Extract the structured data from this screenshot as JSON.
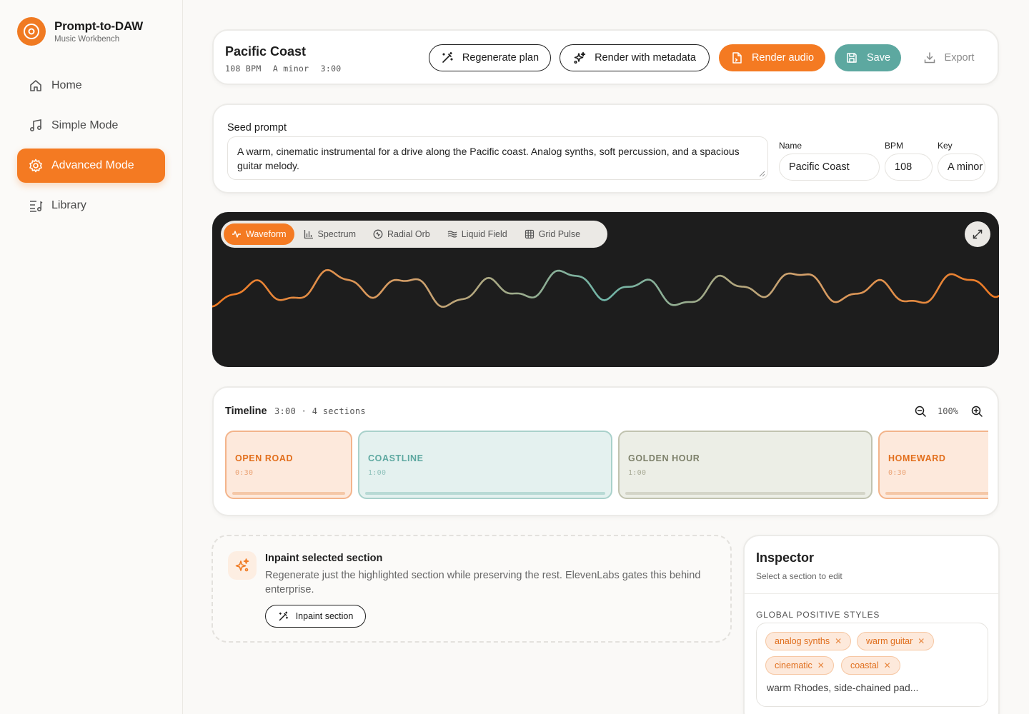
{
  "brand": {
    "title": "Prompt-to-DAW",
    "subtitle": "Music Workbench"
  },
  "nav": [
    {
      "label": "Home",
      "icon": "home-icon",
      "active": false
    },
    {
      "label": "Simple Mode",
      "icon": "music-note-icon",
      "active": false
    },
    {
      "label": "Advanced Mode",
      "icon": "gear-icon",
      "active": true
    },
    {
      "label": "Library",
      "icon": "library-icon",
      "active": false
    }
  ],
  "header": {
    "title": "Pacific Coast",
    "bpm": "108 BPM",
    "key": "A minor",
    "duration": "3:00",
    "regenerate_label": "Regenerate plan",
    "render_meta_label": "Render with metadata",
    "render_audio_label": "Render audio",
    "save_label": "Save",
    "export_label": "Export"
  },
  "seed": {
    "label": "Seed prompt",
    "value": "A warm, cinematic instrumental for a drive along the Pacific coast. Analog synths, soft percussion, and a spacious guitar melody.",
    "name_label": "Name",
    "name_value": "Pacific Coast",
    "bpm_label": "BPM",
    "bpm_value": "108",
    "key_label": "Key",
    "key_value": "A minor"
  },
  "visualizer": {
    "tabs": [
      {
        "label": "Waveform",
        "icon": "waveform-icon",
        "active": true
      },
      {
        "label": "Spectrum",
        "icon": "bar-chart-icon",
        "active": false
      },
      {
        "label": "Radial Orb",
        "icon": "orb-icon",
        "active": false
      },
      {
        "label": "Liquid Field",
        "icon": "waves-icon",
        "active": false
      },
      {
        "label": "Grid Pulse",
        "icon": "grid-icon",
        "active": false
      }
    ],
    "gradient_colors": [
      "#f07a22",
      "#d4a06a",
      "#6fb5a8"
    ]
  },
  "timeline": {
    "title": "Timeline",
    "duration": "3:00",
    "sections_count": "4 sections",
    "zoom": "100%",
    "sections": [
      {
        "name": "OPEN ROAD",
        "duration": "0:30"
      },
      {
        "name": "COASTLINE",
        "duration": "1:00"
      },
      {
        "name": "GOLDEN HOUR",
        "duration": "1:00"
      },
      {
        "name": "HOMEWARD",
        "duration": "0:30"
      }
    ]
  },
  "inpaint": {
    "title": "Inpaint selected section",
    "description": "Regenerate just the highlighted section while preserving the rest. ElevenLabs gates this behind enterprise.",
    "button_label": "Inpaint section"
  },
  "inspector": {
    "title": "Inspector",
    "subtitle": "Select a section to edit",
    "section_label": "GLOBAL POSITIVE STYLES",
    "tags": [
      "analog synths",
      "warm guitar",
      "cinematic",
      "coastal"
    ],
    "input_value": "warm Rhodes, side-chained pad..."
  },
  "colors": {
    "accent": "#f47a22",
    "teal": "#5da8a0",
    "olive": "#8c8f6e"
  }
}
